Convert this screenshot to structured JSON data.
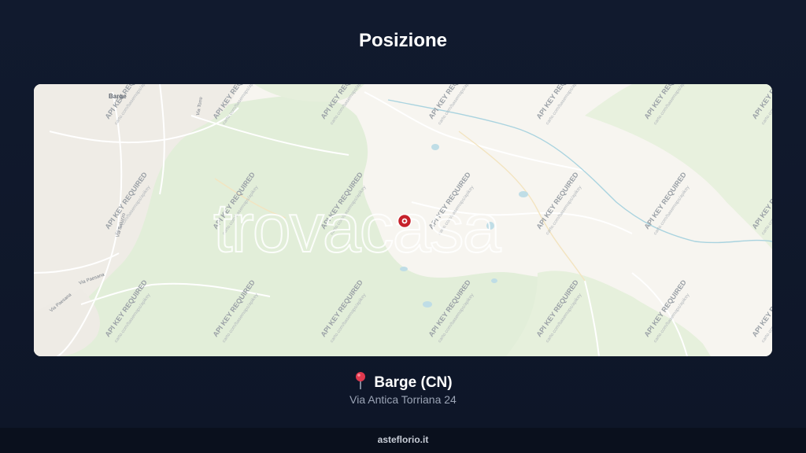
{
  "page": {
    "title": "Posizione"
  },
  "map": {
    "watermark_text": "API KEY REQUIRED",
    "watermark_subtext": "carto.com/basemaps/apikey",
    "logo_text": "trovacasa",
    "town_label": "Barge",
    "street_labels": [
      "Via Torre",
      "Via Saluzzo",
      "Via Paesana",
      "Via Paesana"
    ],
    "colors": {
      "background": "#f7f5f0",
      "forest": "#e2eed9",
      "water": "#a9d3df",
      "marker": "#c6212a"
    }
  },
  "location": {
    "pin_icon": "round-pushpin-icon",
    "name": "Barge (CN)",
    "address": "Via Antica Torriana 24"
  },
  "footer": {
    "brand": "asteflorio.it"
  }
}
